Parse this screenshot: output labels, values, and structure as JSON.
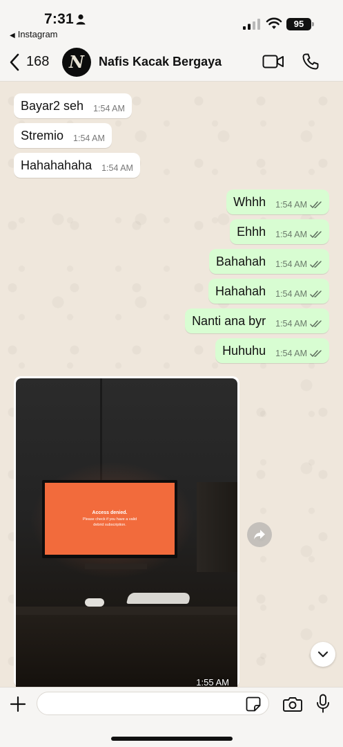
{
  "status_bar": {
    "time": "7:31",
    "back_app": "Instagram",
    "battery": "95"
  },
  "header": {
    "unread_count": "168",
    "avatar_initial": "N",
    "contact_name": "Nafis Kacak Bergaya"
  },
  "messages": [
    {
      "text": "Bayar2 seh",
      "time": "1:54 AM"
    },
    {
      "text": "Stremio",
      "time": "1:54 AM"
    },
    {
      "text": "Hahahahaha",
      "time": "1:54 AM"
    },
    {
      "text": "Whhh",
      "time": "1:54 AM"
    },
    {
      "text": "Ehhh",
      "time": "1:54 AM"
    },
    {
      "text": "Bahahah",
      "time": "1:54 AM"
    },
    {
      "text": "Hahahah",
      "time": "1:54 AM"
    },
    {
      "text": "Nanti ana byr",
      "time": "1:54 AM"
    },
    {
      "text": "Huhuhu",
      "time": "1:54 AM"
    }
  ],
  "media": {
    "time": "1:55 AM",
    "tv_title": "Access denied.",
    "tv_line1": "Please check if you have a valid",
    "tv_line2": "debrid subscription."
  },
  "composer": {
    "placeholder": ""
  },
  "colors": {
    "incoming": "#ffffff",
    "outgoing": "#d8fdd2",
    "chat_bg": "#efe7dc",
    "tick": "#5b6b5b"
  },
  "icons": [
    "person-icon",
    "signal-icon",
    "wifi-icon",
    "back-chevron-icon",
    "video-call-icon",
    "phone-icon",
    "double-check-icon",
    "forward-icon",
    "chevron-down-icon",
    "plus-icon",
    "sticker-icon",
    "camera-icon",
    "microphone-icon"
  ]
}
